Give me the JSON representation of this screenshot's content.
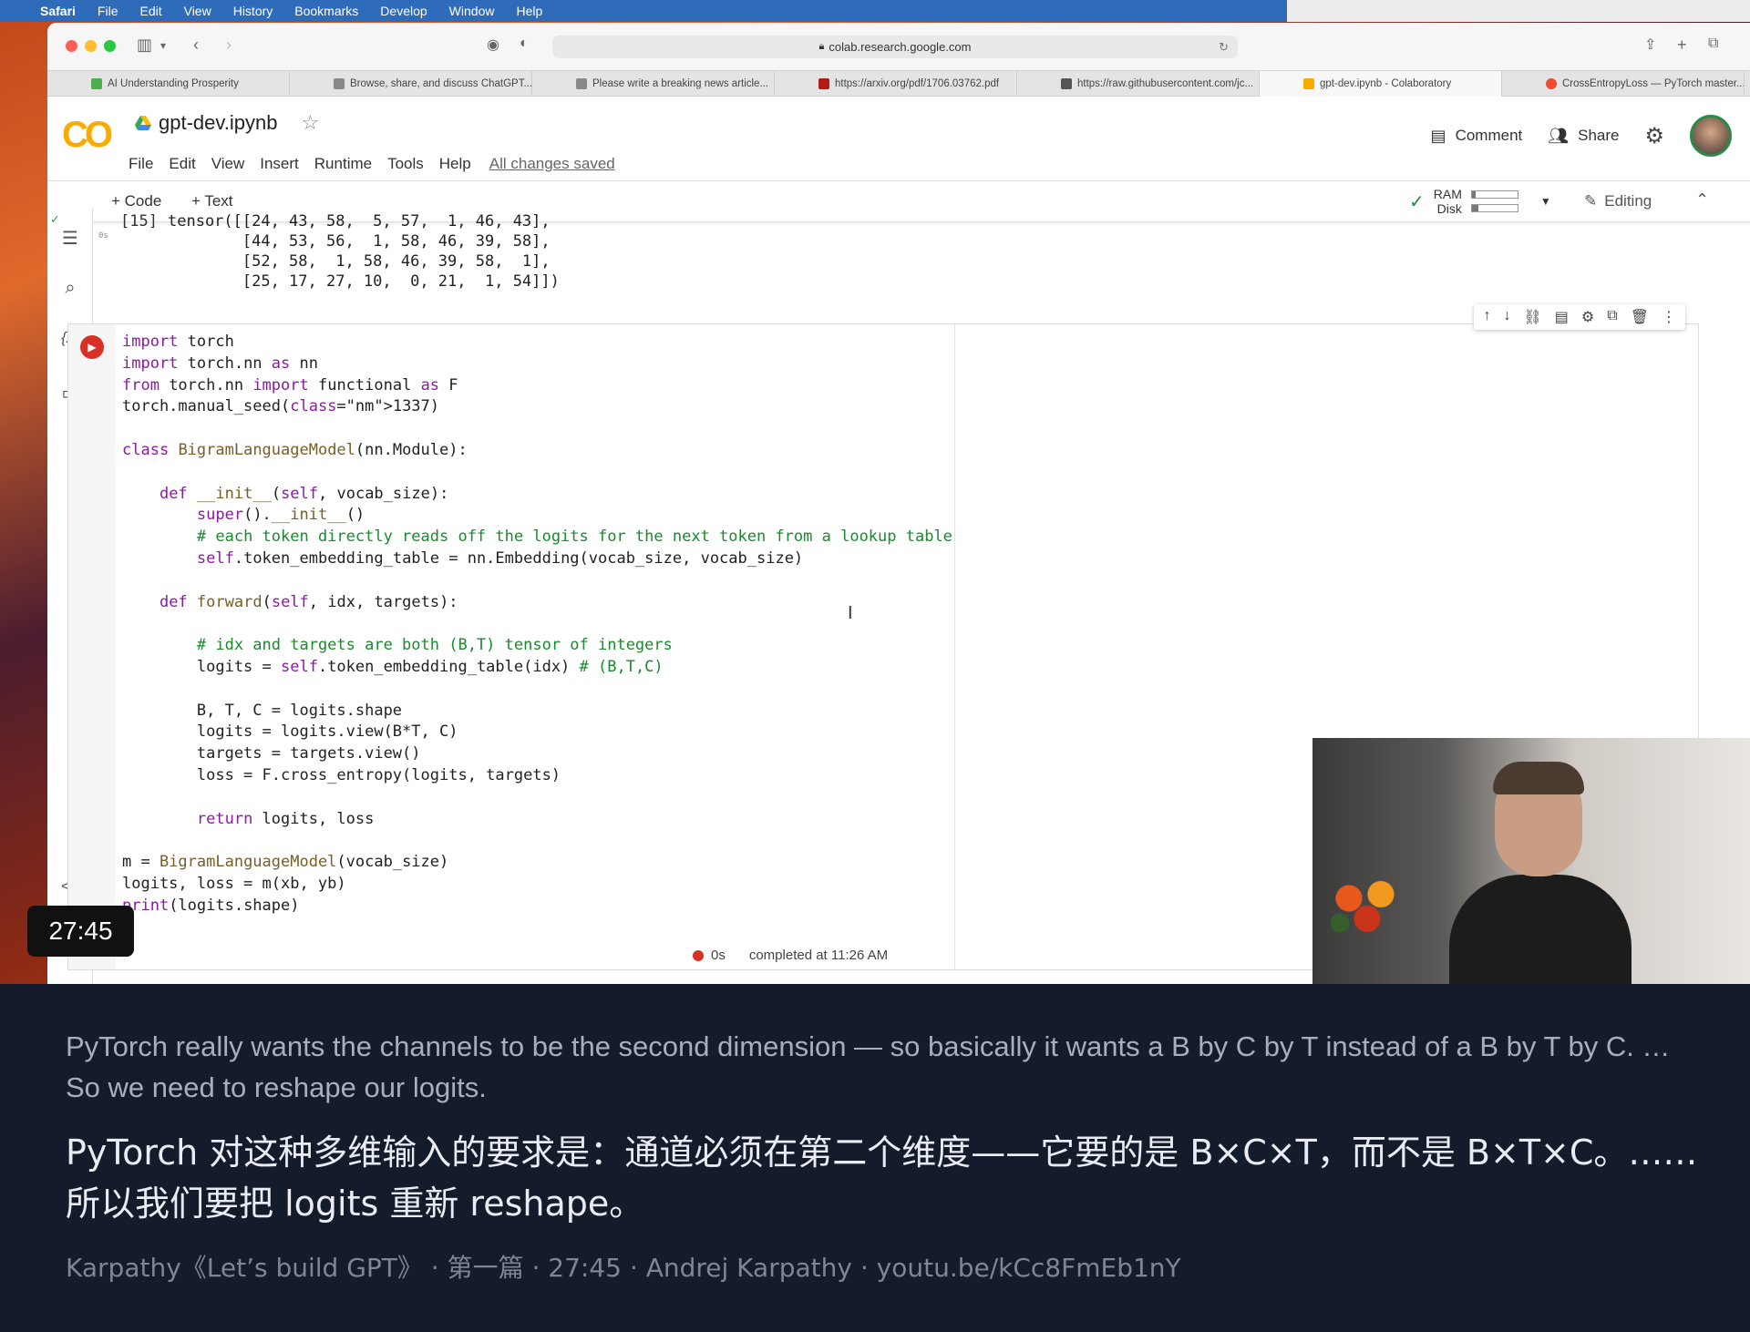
{
  "menubar": {
    "app": "Safari",
    "items": [
      "File",
      "Edit",
      "View",
      "History",
      "Bookmarks",
      "Develop",
      "Window",
      "Help"
    ]
  },
  "browser": {
    "url": "colab.research.google.com",
    "tabs": [
      {
        "label": "AI Understanding Prosperity",
        "color": "#4caf50"
      },
      {
        "label": "Browse, share, and discuss ChatGPT...",
        "color": "#888888"
      },
      {
        "label": "Please write a breaking news article...",
        "color": "#888888"
      },
      {
        "label": "https://arxiv.org/pdf/1706.03762.pdf",
        "color": "#b31b1b"
      },
      {
        "label": "https://raw.githubusercontent.com/jc...",
        "color": "#555555"
      },
      {
        "label": "gpt-dev.ipynb - Colaboratory",
        "color": "#f9ab00"
      },
      {
        "label": "CrossEntropyLoss — PyTorch master...",
        "color": "#ee4c2c"
      }
    ],
    "active_tab": 5
  },
  "colab": {
    "logo": "CO",
    "notebook_title": "gpt-dev.ipynb",
    "menus": [
      "File",
      "Edit",
      "View",
      "Insert",
      "Runtime",
      "Tools",
      "Help"
    ],
    "save_status": "All changes saved",
    "comment_label": "Comment",
    "share_label": "Share",
    "add_code": "+ Code",
    "add_text": "+ Text",
    "ram_label": "RAM",
    "disk_label": "Disk",
    "ram_usage": 0.08,
    "disk_usage": 0.15,
    "editing_label": "Editing"
  },
  "output_cell": {
    "exec_count": "[15]",
    "exec_time": "0s",
    "text": "tensor([[24, 43, 58,  5, 57,  1, 46, 43],\n        [44, 53, 56,  1, 58, 46, 39, 58],\n        [52, 58,  1, 58, 46, 39, 58,  1],\n        [25, 17, 27, 10,  0, 21,  1, 54]])"
  },
  "code_cell": {
    "lines": [
      "import torch",
      "import torch.nn as nn",
      "from torch.nn import functional as F",
      "torch.manual_seed(1337)",
      "",
      "class BigramLanguageModel(nn.Module):",
      "",
      "    def __init__(self, vocab_size):",
      "        super().__init__()",
      "        # each token directly reads off the logits for the next token from a lookup table",
      "        self.token_embedding_table = nn.Embedding(vocab_size, vocab_size)",
      "",
      "    def forward(self, idx, targets):",
      "",
      "        # idx and targets are both (B,T) tensor of integers",
      "        logits = self.token_embedding_table(idx) # (B,T,C)",
      "",
      "        B, T, C = logits.shape",
      "        logits = logits.view(B*T, C)",
      "        targets = targets.view()",
      "        loss = F.cross_entropy(logits, targets)",
      "",
      "        return logits, loss",
      "",
      "m = BigramLanguageModel(vocab_size)",
      "logits, loss = m(xb, yb)",
      "print(logits.shape)"
    ]
  },
  "status": {
    "time": "0s",
    "text": "completed at 11:26 AM"
  },
  "video": {
    "timestamp": "27:45"
  },
  "subtitles": {
    "english": "PyTorch really wants the channels to be the second dimension — so basically it wants a B by C by T instead of a B by T by C. … So we need to reshape our logits.",
    "chinese": "PyTorch 对这种多维输入的要求是：通道必须在第二个维度——它要的是 B×C×T，而不是 B×T×C。……所以我们要把 logits 重新 reshape。",
    "credit": "Karpathy《Let’s build GPT》 · 第一篇 · 27:45 · Andrej Karpathy · youtu.be/kCc8FmEb1nY"
  }
}
